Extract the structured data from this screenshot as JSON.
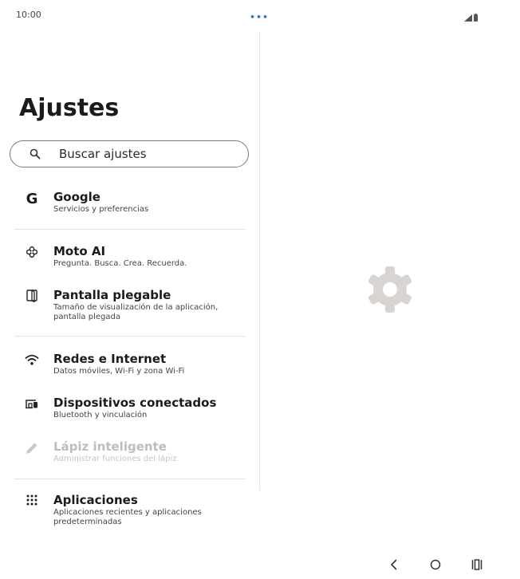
{
  "status_bar": {
    "time": "10:00",
    "more_dots": "•••"
  },
  "settings": {
    "title": "Ajustes",
    "search": {
      "value": "Buscar ajustes"
    },
    "items": [
      {
        "icon": "google-icon",
        "title": "Google",
        "subtitle": "Servicios y preferencias"
      },
      {
        "icon": "moto-ai-icon",
        "title": "Moto AI",
        "subtitle": "Pregunta. Busca. Crea. Recuerda."
      },
      {
        "icon": "foldable-display-icon",
        "title": "Pantalla plegable",
        "subtitle": "Tamaño de visualización de la aplicación, pantalla plegada"
      },
      {
        "icon": "wifi-icon",
        "title": "Redes e Internet",
        "subtitle": "Datos móviles, Wi-Fi y zona Wi-Fi"
      },
      {
        "icon": "connected-devices-icon",
        "title": "Dispositivos conectados",
        "subtitle": "Bluetooth y vinculación"
      },
      {
        "icon": "pen-icon",
        "title": "Lápiz inteligente",
        "subtitle": "Administrar funciones del lápiz",
        "disabled": true
      },
      {
        "icon": "apps-grid-icon",
        "title": "Aplicaciones",
        "subtitle": "Aplicaciones recientes y aplicaciones predeterminadas"
      }
    ],
    "google_letter": "G"
  },
  "detail_pane": {
    "icon": "settings-gear-icon",
    "icon_color": "#d8d4d2"
  },
  "nav_bar": {
    "back": "back-icon",
    "home": "home-icon",
    "recents": "recents-icon"
  },
  "colors": {
    "accent": "#3b6fe0"
  }
}
